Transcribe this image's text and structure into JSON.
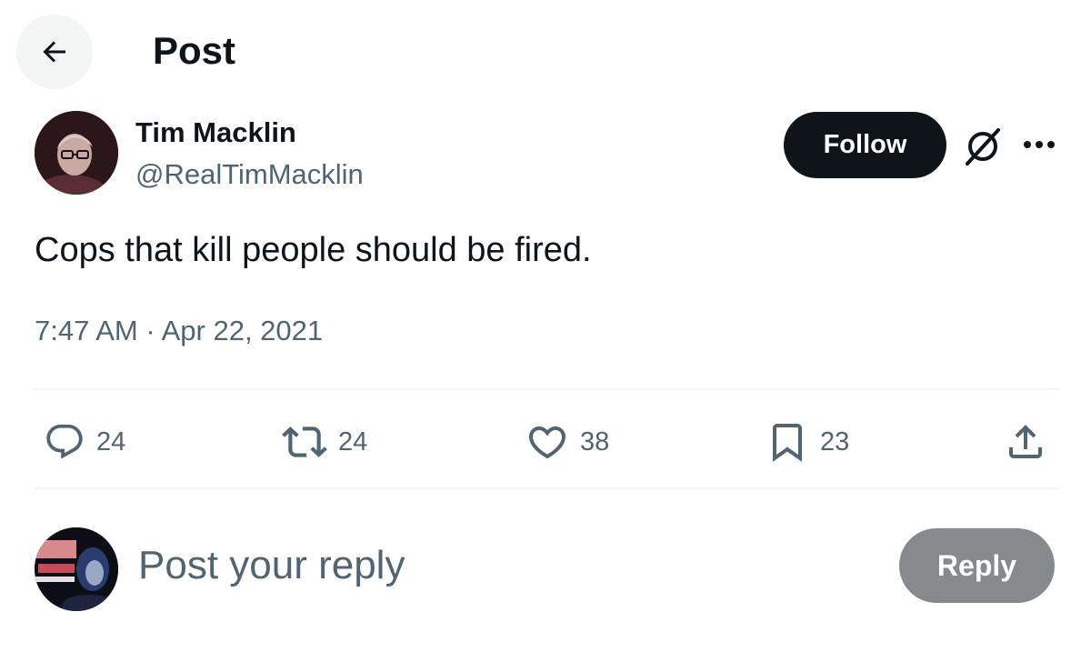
{
  "header": {
    "back_icon": "arrow-left-icon",
    "title": "Post"
  },
  "post": {
    "author": {
      "name": "Tim Macklin",
      "handle": "@RealTimMacklin",
      "avatar": "profile-photo"
    },
    "follow_label": "Follow",
    "header_icons": [
      "grok-icon",
      "more-horizontal-icon"
    ],
    "text": "Cops that kill people should be fired.",
    "time": "7:47 AM",
    "separator": "·",
    "date": "Apr 22, 2021"
  },
  "actions": {
    "reply": {
      "icon": "comment-icon",
      "count": "24"
    },
    "repost": {
      "icon": "repost-icon",
      "count": "24"
    },
    "like": {
      "icon": "heart-icon",
      "count": "38"
    },
    "bookmark": {
      "icon": "bookmark-icon",
      "count": "23"
    },
    "share": {
      "icon": "share-icon"
    }
  },
  "composer": {
    "placeholder": "Post your reply",
    "button_label": "Reply"
  },
  "colors": {
    "text_primary": "#0f1419",
    "text_secondary": "#536471",
    "follow_button": "#0f1419",
    "reply_button_disabled": "#878a8c",
    "divider": "#eff3f4"
  }
}
